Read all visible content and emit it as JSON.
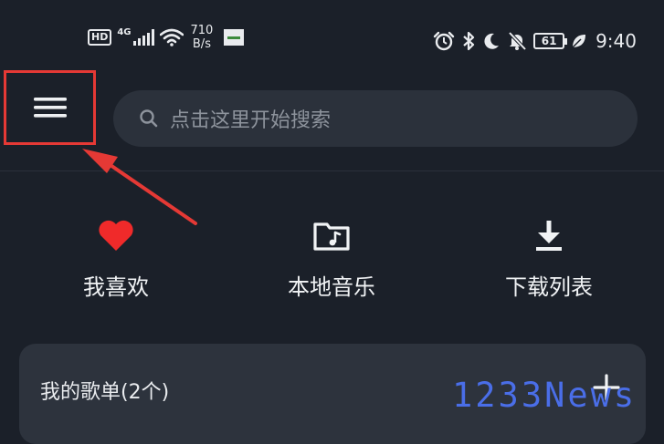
{
  "status_bar": {
    "hd_label": "HD",
    "network_generation": "4G",
    "speed_value": "710",
    "speed_unit": "B/s",
    "battery_level": "61",
    "time": "9:40"
  },
  "header": {
    "menu_icon": "hamburger-menu-icon",
    "search_placeholder": "点击这里开始搜索"
  },
  "quick_actions": [
    {
      "label": "我喜欢",
      "icon": "heart-icon",
      "color": "#f02a2a"
    },
    {
      "label": "本地音乐",
      "icon": "music-folder-icon",
      "color": "#f1f3f5"
    },
    {
      "label": "下载列表",
      "icon": "download-icon",
      "color": "#f1f3f5"
    }
  ],
  "playlists": {
    "title": "我的歌单(2个)",
    "add_icon": "plus-icon"
  },
  "watermark": "1233News",
  "colors": {
    "background": "#1b2029",
    "card": "#2d333d",
    "search_bg": "#2b313b",
    "highlight": "#e53935",
    "watermark": "#4a6ee8"
  }
}
